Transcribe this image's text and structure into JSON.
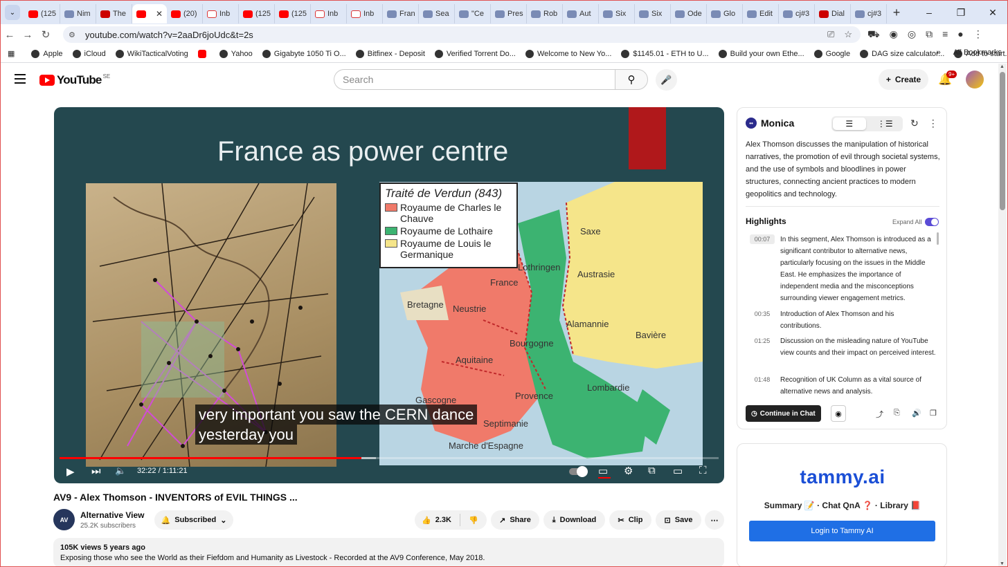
{
  "browser": {
    "tabs": [
      {
        "label": "(125",
        "fav": "yt"
      },
      {
        "label": "Nim",
        "fav": "misc"
      },
      {
        "label": "The",
        "fav": "red"
      },
      {
        "label": "",
        "fav": "yt",
        "active": true
      },
      {
        "label": "(20)",
        "fav": "yt"
      },
      {
        "label": "Inb",
        "fav": "gm"
      },
      {
        "label": "(125",
        "fav": "yt"
      },
      {
        "label": "(125",
        "fav": "yt"
      },
      {
        "label": "Inb",
        "fav": "gm"
      },
      {
        "label": "Inb",
        "fav": "gm"
      },
      {
        "label": "Fran",
        "fav": "misc"
      },
      {
        "label": "Sea",
        "fav": "misc"
      },
      {
        "label": "\"Ce",
        "fav": "misc"
      },
      {
        "label": "Pres",
        "fav": "misc"
      },
      {
        "label": "Rob",
        "fav": "misc"
      },
      {
        "label": "Aut",
        "fav": "misc"
      },
      {
        "label": "Six",
        "fav": "misc"
      },
      {
        "label": "Six",
        "fav": "misc"
      },
      {
        "label": "Ode",
        "fav": "misc"
      },
      {
        "label": "Glo",
        "fav": "misc"
      },
      {
        "label": "Edit",
        "fav": "misc"
      },
      {
        "label": "cj#3",
        "fav": "misc"
      },
      {
        "label": "Dial",
        "fav": "red"
      },
      {
        "label": "cj#3",
        "fav": "misc"
      }
    ],
    "url": "youtube.com/watch?v=2aaDr6joUdc&t=2s",
    "bookmarks": [
      "Apple",
      "iCloud",
      "WikiTacticalVoting",
      "",
      "Yahoo",
      "Gigabyte 1050 Ti O...",
      "Bitfinex - Deposit",
      "Verified Torrent Do...",
      "Welcome to New Yo...",
      "$1145.01 - ETH to U...",
      "Build your own Ethe...",
      "Google",
      "DAG size calculator...",
      "Add to start.me"
    ],
    "all_bookmarks": "All Bookmarks",
    "more": "»"
  },
  "youtube": {
    "logo_text": "YouTube",
    "region": "SE",
    "search_placeholder": "Search",
    "create_label": "Create",
    "notif_badge": "9+"
  },
  "video": {
    "slide_title": "France as power centre",
    "legend": {
      "title": "Traité de Verdun (843)",
      "items": [
        {
          "label": "Royaume de Charles le Chauve",
          "color": "#f07a6a"
        },
        {
          "label": "Royaume de Lothaire",
          "color": "#3cb371"
        },
        {
          "label": "Royaume de Louis le Germanique",
          "color": "#f5e58a"
        }
      ]
    },
    "map_labels": [
      "Saxe",
      "Lothringen",
      "France",
      "Austrasie",
      "Bretagne",
      "Neustrie",
      "Alamannie",
      "Bavière",
      "Bourgogne",
      "Aquitaine",
      "Lombardie",
      "Provence",
      "Gascogne",
      "Septimanie",
      "Marche d'Espagne"
    ],
    "caption_lines": [
      "very important you saw the CERN dance",
      "yesterday you"
    ],
    "time": "32:22 / 1:11:21",
    "played_fraction": 0.458,
    "title": "AV9 - Alex Thomson - INVENTORS of EVIL THINGS ...",
    "channel": "Alternative View",
    "channel_avatar_text": "AV",
    "subscribers": "25.2K subscribers",
    "subscribed_label": "Subscribed",
    "likes": "2.3K",
    "share_label": "Share",
    "download_label": "Download",
    "clip_label": "Clip",
    "save_label": "Save",
    "views": "105K views  5 years ago",
    "description": "Exposing those who see the World as their Fiefdom and Humanity as Livestock - Recorded at the AV9 Conference, May 2018."
  },
  "monica": {
    "name": "Monica",
    "summary": "Alex Thomson discusses the manipulation of historical narratives, the promotion of evil through societal systems, and the use of symbols and bloodlines in power structures, connecting ancient practices to modern geopolitics and technology.",
    "highlights_label": "Highlights",
    "expand_all": "Expand All",
    "highlights": [
      {
        "time": "00:07",
        "text": "In this segment, Alex Thomson is introduced as a significant contributor to alternative news, particularly focusing on the issues in the Middle East. He emphasizes the importance of independent media and the misconceptions surrounding viewer engagement metrics."
      },
      {
        "time": "00:35",
        "text": "Introduction of Alex Thomson and his contributions."
      },
      {
        "time": "01:25",
        "text": "Discussion on the misleading nature of YouTube view counts and their impact on perceived interest."
      },
      {
        "time": "01:48",
        "text": "Recognition of UK Column as a vital source of alternative news and analysis."
      }
    ],
    "continue_label": "Continue in Chat"
  },
  "tammy": {
    "logo": "tammy.ai",
    "links": "Summary 📝 · Chat QnA ❓ · Library 📕",
    "login_label": "Login to Tammy AI"
  }
}
